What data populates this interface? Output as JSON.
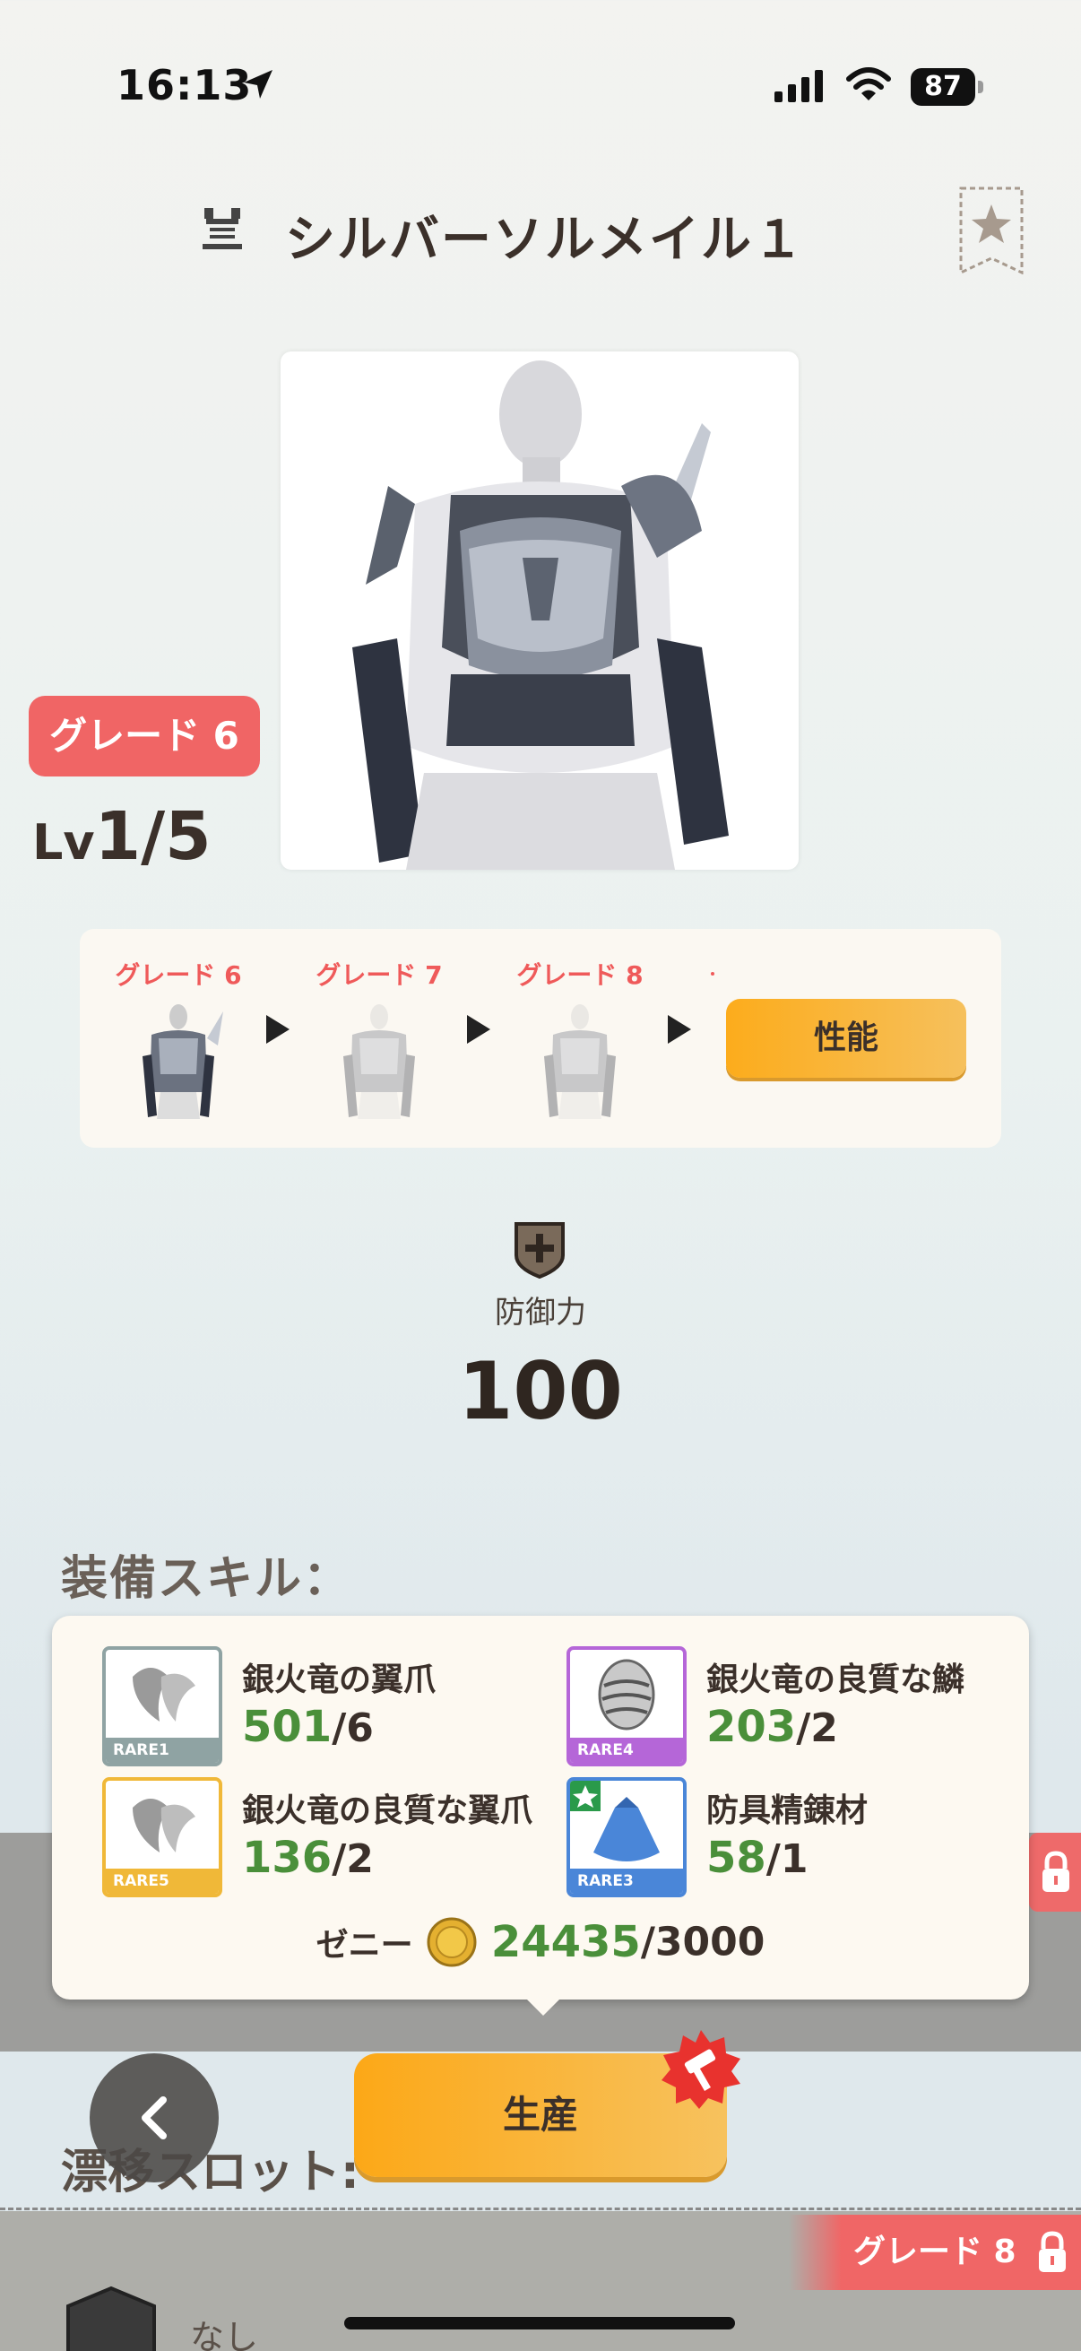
{
  "status_bar": {
    "time": "16:13",
    "battery": "87",
    "icons": [
      "location-arrow-icon",
      "cellular-signal-icon",
      "wifi-icon",
      "battery-icon"
    ]
  },
  "header": {
    "title": "シルバーソルメイル１",
    "icon": "armor-type-icon",
    "favorite_icon": "star-bookmark-icon"
  },
  "item": {
    "grade_badge": "グレード 6",
    "level_prefix": "Lv",
    "level": "1/5"
  },
  "grades": {
    "steps": [
      {
        "label": "グレード 6"
      },
      {
        "label": "グレード 7"
      },
      {
        "label": "グレード 8"
      }
    ],
    "performance_button": "性能"
  },
  "stat": {
    "label": "防御力",
    "value": "100"
  },
  "skills_heading": "装備スキル：",
  "materials": [
    {
      "name": "銀火竜の翼爪",
      "have": "501",
      "need": "/6",
      "rarity": "RARE1",
      "rarity_color": "#8fa3a3",
      "icon": "claw-material-icon"
    },
    {
      "name": "銀火竜の良質な鱗",
      "have": "203",
      "need": "/2",
      "rarity": "RARE4",
      "rarity_color": "#b566d8",
      "icon": "scale-material-icon"
    },
    {
      "name": "銀火竜の良質な翼爪",
      "have": "136",
      "need": "/2",
      "rarity": "RARE5",
      "rarity_color": "#f0b838",
      "icon": "claw-material-icon"
    },
    {
      "name": "防具精錬材",
      "have": "58",
      "need": "/1",
      "rarity": "RARE3",
      "rarity_color": "#4a86d8",
      "icon": "refining-bag-icon"
    }
  ],
  "zeny": {
    "label": "ゼニー",
    "have": "24435",
    "need": "/3000",
    "icon": "zeny-coin-icon"
  },
  "drift_slot": {
    "heading": "漂移スロット:",
    "empty_label": "なし"
  },
  "grade_lock_tab": {
    "label": "グレード 8"
  },
  "buttons": {
    "produce": "生産",
    "back_icon": "chevron-left-icon"
  }
}
